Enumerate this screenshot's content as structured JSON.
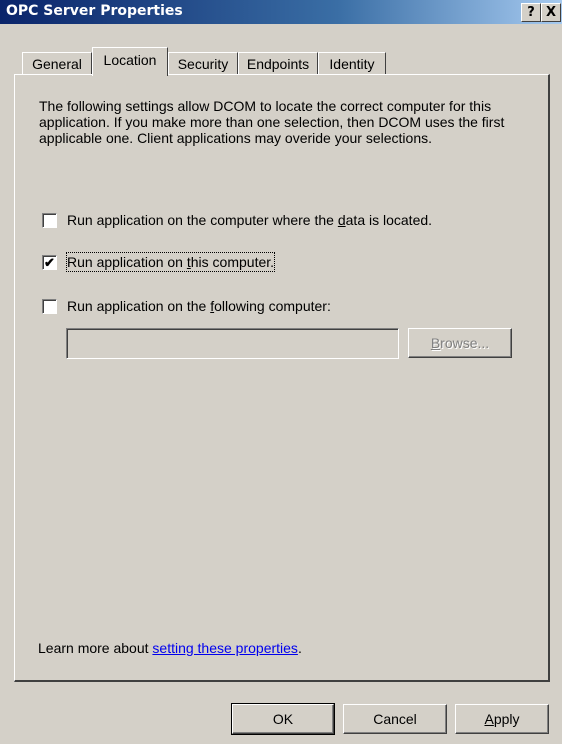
{
  "window": {
    "title": "OPC Server Properties",
    "help_button": "?",
    "close_button": "X"
  },
  "tabs": [
    {
      "label": "General"
    },
    {
      "label": "Location"
    },
    {
      "label": "Security"
    },
    {
      "label": "Endpoints"
    },
    {
      "label": "Identity"
    }
  ],
  "active_tab": "Location",
  "location": {
    "description": "The following settings allow DCOM to locate the correct computer for this application. If you make more than one selection, then DCOM uses the first applicable one. Client applications may overide your selections.",
    "options": [
      {
        "label_pre": "Run application on the computer where the ",
        "label_access": "d",
        "label_post": "ata is located.",
        "checked": false
      },
      {
        "label_pre": "Run application on ",
        "label_access": "t",
        "label_post": "his computer.",
        "checked": true
      },
      {
        "label_pre": "Run application on the ",
        "label_access": "f",
        "label_post": "ollowing computer:",
        "checked": false
      }
    ],
    "computer_name_value": "",
    "browse_button_access": "B",
    "browse_button_rest": "rowse...",
    "learn_more_prefix": "Learn more about ",
    "learn_more_link": "setting these properties",
    "learn_more_suffix": "."
  },
  "buttons": {
    "ok": "OK",
    "cancel": "Cancel",
    "apply_access": "A",
    "apply_rest": "pply"
  }
}
